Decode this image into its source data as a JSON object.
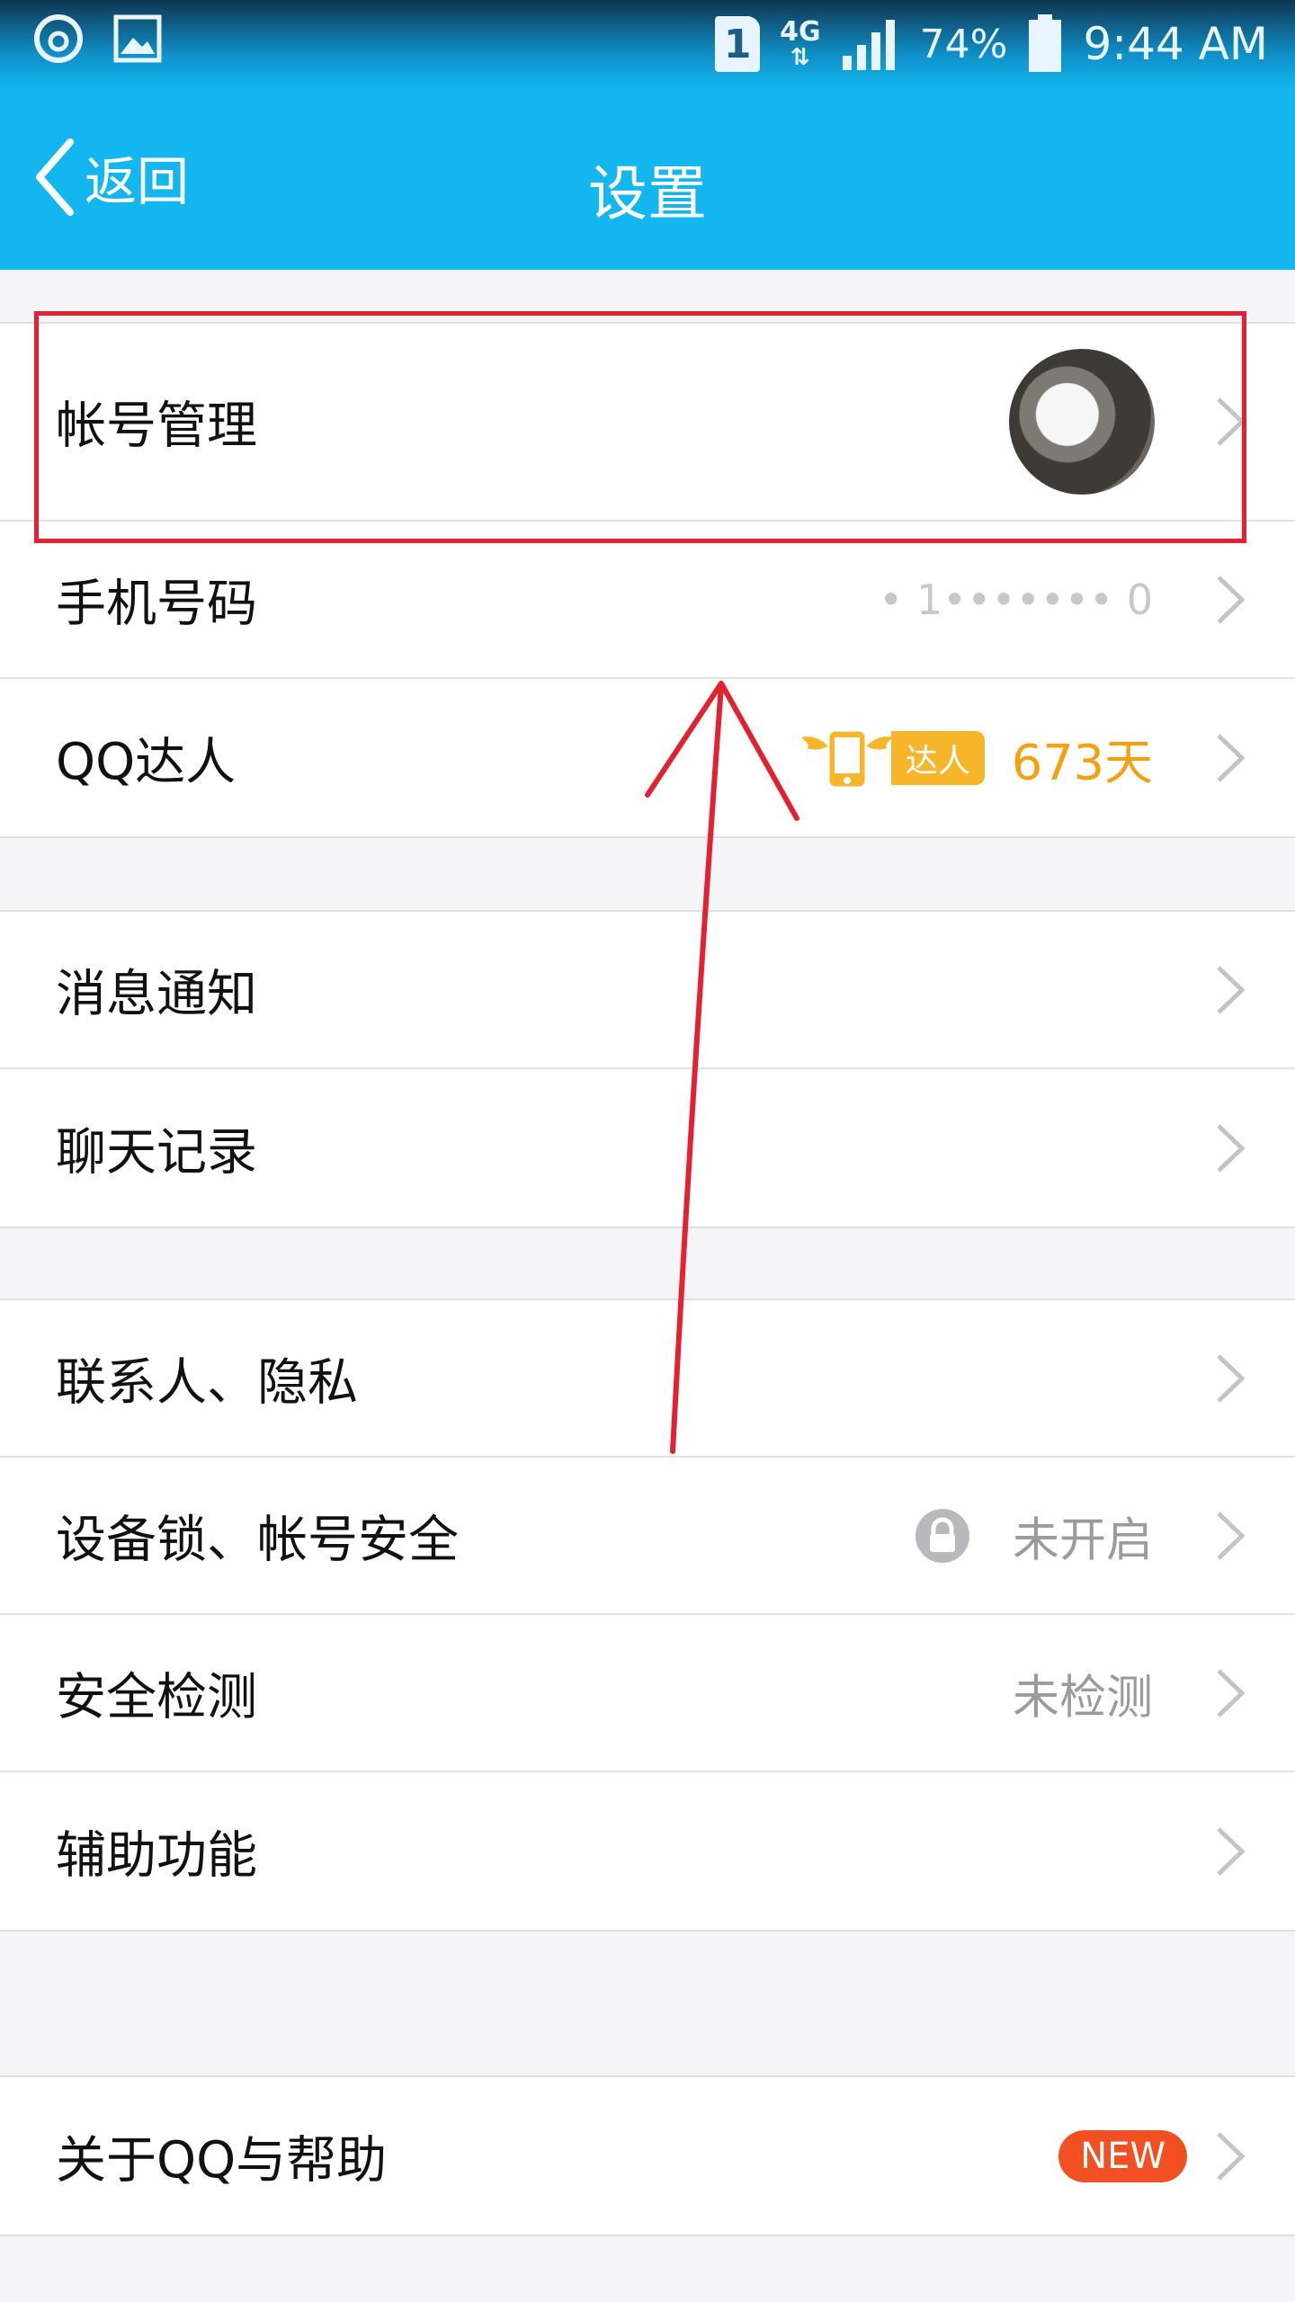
{
  "status_bar": {
    "sim": "1",
    "network": "4G",
    "battery": "74%",
    "time": "9:44 AM"
  },
  "header": {
    "back_label": "返回",
    "title": "设置"
  },
  "groups": [
    {
      "rows": [
        {
          "label": "帐号管理"
        },
        {
          "label": "手机号码",
          "value": "• 1••••••• 0"
        },
        {
          "label": "QQ达人",
          "badge": "达人",
          "days": "673天"
        }
      ]
    },
    {
      "rows": [
        {
          "label": "消息通知"
        },
        {
          "label": "聊天记录"
        }
      ]
    },
    {
      "rows": [
        {
          "label": "联系人、隐私"
        },
        {
          "label": "设备锁、帐号安全",
          "value": "未开启"
        },
        {
          "label": "安全检测",
          "value": "未检测"
        },
        {
          "label": "辅助功能"
        }
      ]
    },
    {
      "rows": [
        {
          "label": "关于QQ与帮助",
          "badge": "NEW"
        }
      ]
    }
  ],
  "colors": {
    "title_bar": "#14b6f0",
    "accent_orange": "#f5a00e",
    "new_badge": "#f25023",
    "annotation_red": "#e22231"
  }
}
